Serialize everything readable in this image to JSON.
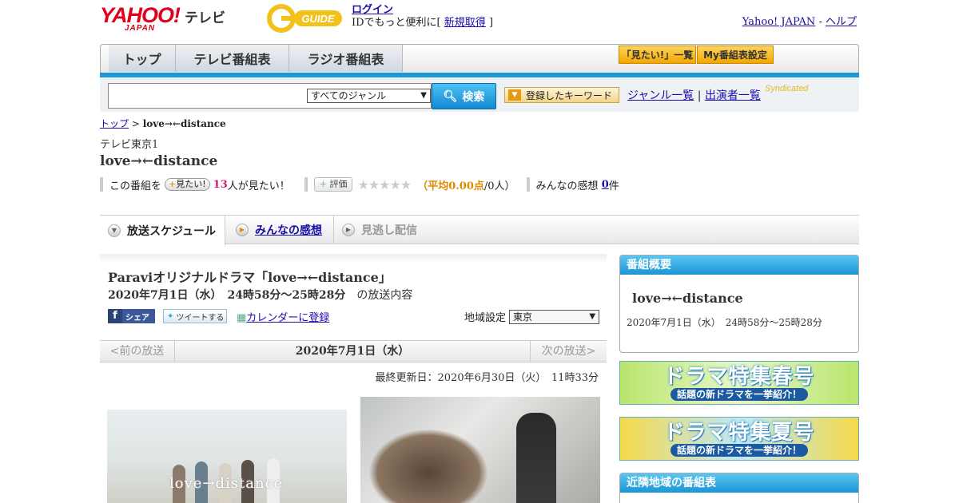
{
  "header": {
    "yahoo": "YAHOO!",
    "japan": "JAPAN",
    "tv": "テレビ",
    "gguide": "G-GUIDE",
    "login": "ログイン",
    "login_sub_prefix": "IDでもっと便利に[",
    "register": "新規取得",
    "login_sub_suffix": "]",
    "yj_link": "Yahoo! JAPAN",
    "sep": " - ",
    "help": "ヘルプ"
  },
  "nav": {
    "tabs": [
      "トップ",
      "テレビ番組表",
      "ラジオ番組表"
    ],
    "mitai_list": "「見たい!」一覧",
    "my_settings": "My番組表設定"
  },
  "search": {
    "genre": "すべてのジャンル",
    "button": "検索",
    "keyword_button": "登録したキーワード",
    "genre_list": "ジャンル一覧",
    "cast_list": "出演者一覧",
    "syndicated": "Syndicated"
  },
  "breadcrumb": {
    "top": "トップ",
    "sep": " > ",
    "current": "love→←distance"
  },
  "program": {
    "station": "テレビ東京1",
    "title": "love→←distance",
    "mitai_prefix": "この番組を",
    "mitai_btn": "見たい!",
    "mitai_count": "13",
    "mitai_suffix": "人が見たい！",
    "rate_btn": "評価",
    "stars": "★★★★★",
    "avg_open": "（",
    "avg": "平均0.00点",
    "avg_count": "/0人）",
    "impressions_label": "みんなの感想",
    "impressions_count": "0",
    "impressions_suffix": "件"
  },
  "tabs": {
    "schedule": "放送スケジュール",
    "impressions": "みんなの感想",
    "missed": "見逃し配信"
  },
  "detail": {
    "title": "Paraviオリジナルドラマ「love→←distance」",
    "datetime": "2020年7月1日（水）　24時58分～25時28分",
    "datetime_suffix": "の放送内容",
    "share": "シェア",
    "tweet": "ツイートする",
    "calendar": "カレンダーに登録",
    "region_label": "地域設定",
    "region": "東京",
    "prev": "<前の放送",
    "current_date": "2020年7月1日（水）",
    "next": "次の放送>",
    "updated": "最終更新日：2020年6月30日（火）　11時33分",
    "image_text": "love→distance"
  },
  "sidebar": {
    "overview_head": "番組概要",
    "overview_title": "love→←distance",
    "overview_date": "2020年7月1日（水）　24時58分～25時28分",
    "banner_spring_1": "ドラマ特集春号",
    "banner_spring_2": "話題の新ドラマを一挙紹介！",
    "banner_summer_1": "ドラマ特集夏号",
    "banner_summer_2": "話題の新ドラマを一挙紹介！",
    "nearby_head": "近隣地域の番組表"
  },
  "colors": {
    "accent_blue": "#1a98d8",
    "yahoo_red": "#e0001a",
    "pink": "#d01a75",
    "orange": "#e08a00"
  }
}
